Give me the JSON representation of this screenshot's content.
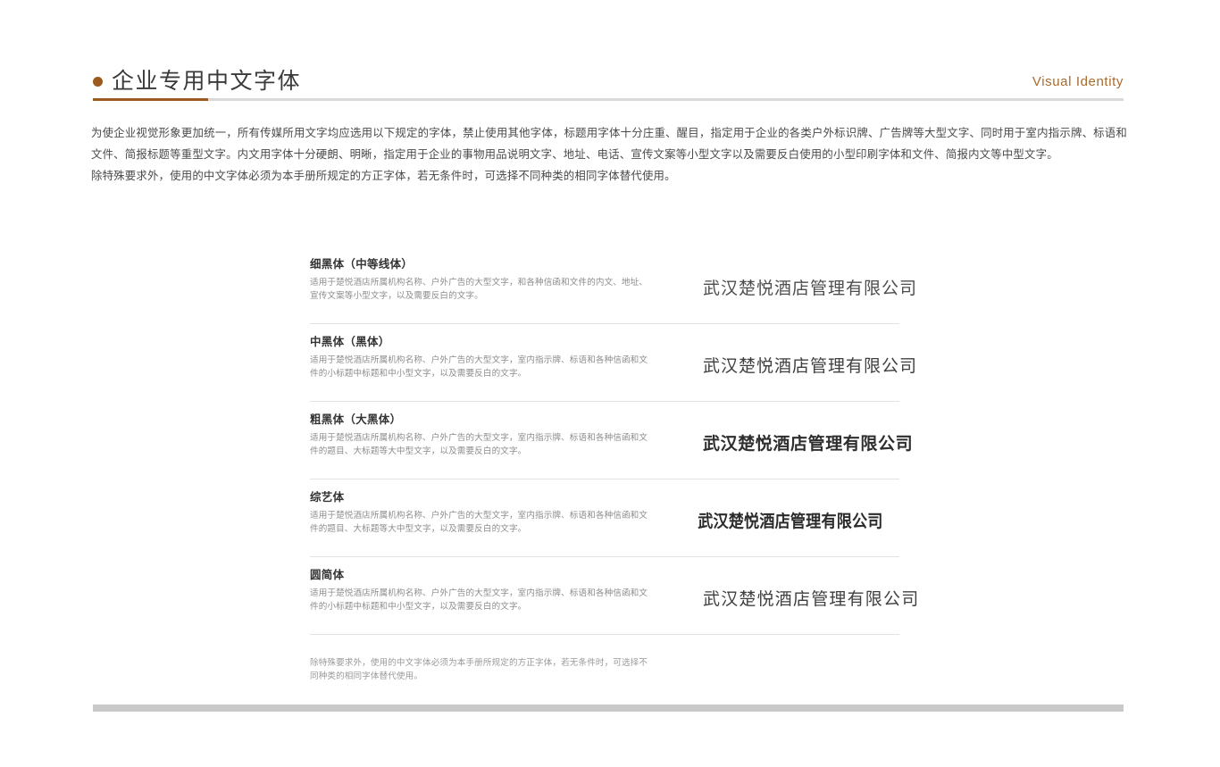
{
  "header": {
    "title": "企业专用中文字体",
    "section_tag": "Visual Identity",
    "accent_color": "#9c5a20",
    "rule_color": "#d9d9d9"
  },
  "intro": {
    "paragraph_1": "为使企业视觉形象更加统一，所有传媒所用文字均应选用以下规定的字体，禁止使用其他字体，标题用字体十分庄重、醒目，指定用于企业的各类户外标识牌、广告牌等大型文字、同时用于室内指示牌、标语和文件、简报标题等重型文字。内文用字体十分硬朗、明晰，指定用于企业的事物用品说明文字、地址、电话、宣传文案等小型文字以及需要反白使用的小型印刷字体和文件、简报内文等中型文字。",
    "paragraph_2": "除特殊要求外，使用的中文字体必须为本手册所规定的方正字体，若无条件时，可选择不同种类的相同字体替代使用。"
  },
  "specimens": [
    {
      "name": "细黑体（中等线体）",
      "detail": "适用于楚悦酒店所属机构名称、户外广告的大型文字，和各种信函和文件的内文、地址、宣传文案等小型文字，以及需要反白的文字。",
      "sample": "武汉楚悦酒店管理有限公司",
      "style": "w-light"
    },
    {
      "name": "中黑体（黑体）",
      "detail": "适用于楚悦酒店所属机构名称、户外广告的大型文字，室内指示牌、标语和各种信函和文件的小标题中标题和中小型文字，以及需要反白的文字。",
      "sample": "武汉楚悦酒店管理有限公司",
      "style": "w-regular"
    },
    {
      "name": "粗黑体（大黑体）",
      "detail": "适用于楚悦酒店所属机构名称、户外广告的大型文字，室内指示牌、标语和各种信函和文件的题目、大标题等大中型文字，以及需要反白的文字。",
      "sample": "武汉楚悦酒店管理有限公司",
      "style": "w-bold"
    },
    {
      "name": "综艺体",
      "detail": "适用于楚悦酒店所属机构名称、户外广告的大型文字，室内指示牌、标语和各种信函和文件的题目、大标题等大中型文字，以及需要反白的文字。",
      "sample": "武汉楚悦酒店管理有限公司",
      "style": "w-display"
    },
    {
      "name": "圆简体",
      "detail": "适用于楚悦酒店所属机构名称、户外广告的大型文字，室内指示牌、标语和各种信函和文件的小标题中标题和中小型文字，以及需要反白的文字。",
      "sample": "武汉楚悦酒店管理有限公司",
      "style": "w-round"
    }
  ],
  "footnote": {
    "text": "除特殊要求外，使用的中文字体必须为本手册所规定的方正字体，若无条件时，可选择不同种类的相同字体替代使用。"
  },
  "bottom_bar": {
    "color": "#c9c9c9"
  }
}
